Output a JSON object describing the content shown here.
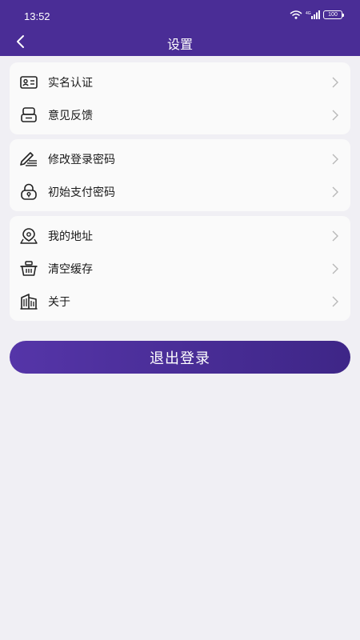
{
  "status_bar": {
    "time": "13:52",
    "battery": "100"
  },
  "nav": {
    "title": "设置"
  },
  "groups": [
    {
      "items": [
        {
          "label": "实名认证",
          "icon": "id-card-icon"
        },
        {
          "label": "意见反馈",
          "icon": "feedback-icon"
        }
      ]
    },
    {
      "items": [
        {
          "label": "修改登录密码",
          "icon": "edit-pen-icon"
        },
        {
          "label": "初始支付密码",
          "icon": "lock-icon"
        }
      ]
    },
    {
      "items": [
        {
          "label": "我的地址",
          "icon": "location-icon"
        },
        {
          "label": "清空缓存",
          "icon": "basket-icon"
        },
        {
          "label": "关于",
          "icon": "building-icon"
        }
      ]
    }
  ],
  "logout_label": "退出登录",
  "colors": {
    "header": "#4a2d96",
    "button": "#4e31a0",
    "background": "#f0eff4"
  }
}
